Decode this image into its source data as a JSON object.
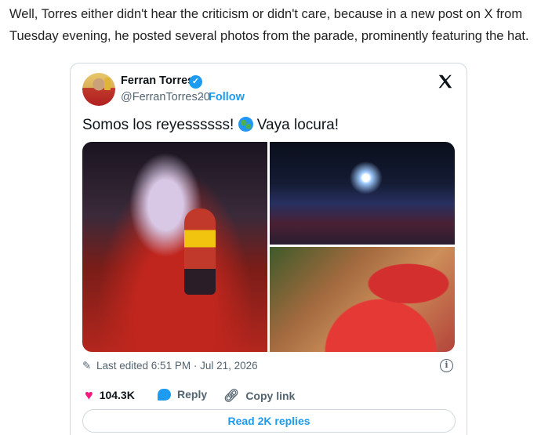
{
  "article": {
    "paragraph": "Well, Torres either didn't hear the criticism or didn't care, because in a new post on X from Tuesday evening, he posted several photos from the parade, prominently featuring the hat."
  },
  "tweet": {
    "author_name": "Ferran Torres",
    "handle": "@FerranTorres20",
    "separator": "·",
    "follow_label": "Follow",
    "text_before_icon": "Somos los reyessssss!",
    "text_after_icon": "Vaya locura!",
    "icons": {
      "verified": "verified-badge-icon",
      "platform": "x-logo-icon",
      "globe": "globe-emoji-icon",
      "pencil": "pencil-icon",
      "info": "info-icon",
      "like": "heart-icon",
      "reply": "speech-bubble-icon",
      "copy": "link-icon"
    },
    "edited_text": "Last edited 6:51 PM · Jul 21, 2026",
    "likes_count": "104.3K",
    "reply_label": "Reply",
    "copy_link_label": "Copy link",
    "read_replies_label": "Read 2K replies",
    "colors": {
      "accent": "#1d9bf0",
      "like": "#f91880",
      "muted": "#536471"
    }
  }
}
